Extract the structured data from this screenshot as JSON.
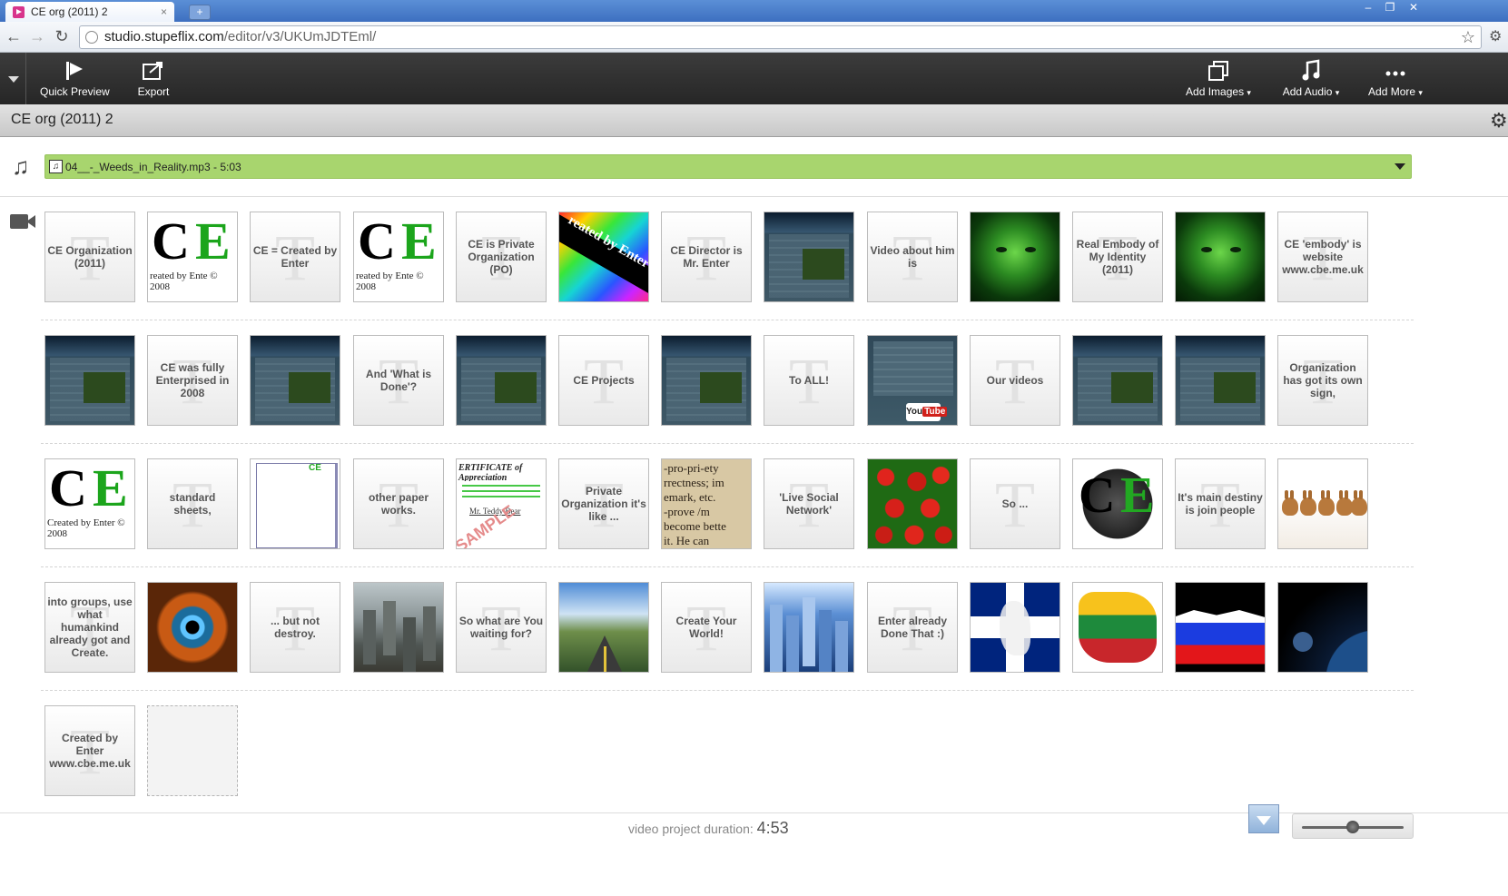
{
  "browser": {
    "tab_title": "CE org (2011) 2",
    "tab_close": "×",
    "new_tab": "+",
    "url_host": "studio.stupeflix.com",
    "url_path": "/editor/v3/UKUmJDTEml/",
    "window_controls": [
      "–",
      "❐",
      "✕"
    ],
    "nav": {
      "back": "←",
      "forward": "→",
      "reload": "↻",
      "star": "☆",
      "wrench": "⚙"
    }
  },
  "toolbar": {
    "quick_preview": "Quick Preview",
    "export": "Export",
    "add_images": "Add Images",
    "add_audio": "Add Audio",
    "add_more": "Add More",
    "caret": "▾"
  },
  "project": {
    "title": "CE org (2011) 2",
    "settings_icon": "⚙"
  },
  "audio": {
    "icon": "♫",
    "track_icon": "♫",
    "track": "04__-_Weeds_in_Reality.mp3 - 5:03",
    "track_color": "#a8d56e"
  },
  "storyboard": {
    "rows": [
      [
        {
          "kind": "text",
          "text": "CE Organization (2011)"
        },
        {
          "kind": "image",
          "style": "ce",
          "text": "CE",
          "sub": "reated by Ente © 2008"
        },
        {
          "kind": "text",
          "text": "CE = Created by Enter"
        },
        {
          "kind": "image",
          "style": "ce",
          "text": "CE",
          "sub": "reated by Ente © 2008"
        },
        {
          "kind": "text",
          "text": "CE is Private Organization (PO)"
        },
        {
          "kind": "image",
          "style": "rainbow",
          "text": "reated by Enter"
        },
        {
          "kind": "text",
          "text": "CE Director is Mr. Enter"
        },
        {
          "kind": "image",
          "style": "site"
        },
        {
          "kind": "text",
          "text": "Video about him is"
        },
        {
          "kind": "image",
          "style": "green"
        },
        {
          "kind": "text",
          "text": "Real Embody of My Identity (2011)"
        },
        {
          "kind": "image",
          "style": "green"
        },
        {
          "kind": "text",
          "text": "CE 'embody' is website www.cbe.me.uk"
        }
      ],
      [
        {
          "kind": "image",
          "style": "site"
        },
        {
          "kind": "text",
          "text": "CE was fully Enterprised in 2008"
        },
        {
          "kind": "image",
          "style": "site"
        },
        {
          "kind": "text",
          "text": "And 'What is Done'?"
        },
        {
          "kind": "image",
          "style": "site"
        },
        {
          "kind": "text",
          "text": "CE Projects"
        },
        {
          "kind": "image",
          "style": "site"
        },
        {
          "kind": "text",
          "text": "To ALL!"
        },
        {
          "kind": "image",
          "style": "yt",
          "text": "You Tube"
        },
        {
          "kind": "text",
          "text": "Our videos"
        },
        {
          "kind": "image",
          "style": "site"
        },
        {
          "kind": "image",
          "style": "site"
        },
        {
          "kind": "text",
          "text": "Organization has got its own sign,"
        }
      ],
      [
        {
          "kind": "image",
          "style": "ce",
          "text": "CE",
          "sub": "Created by Enter © 2008"
        },
        {
          "kind": "text",
          "text": "standard sheets,"
        },
        {
          "kind": "image",
          "style": "paper",
          "text": "CE"
        },
        {
          "kind": "text",
          "text": "other paper works."
        },
        {
          "kind": "image",
          "style": "cert",
          "text": "ERTIFICATE of Appreciation",
          "sub": "Mr. Teddy Bear",
          "mark": "SAMPLE"
        },
        {
          "kind": "text",
          "text": "Private Organization it's like ..."
        },
        {
          "kind": "image",
          "style": "dict",
          "text": "-pro-pri-ety|rrectness; im|emark, etc.|-prove /m|become bette|it. He can|d health. I"
        },
        {
          "kind": "text",
          "text": "'Live Social Network'"
        },
        {
          "kind": "image",
          "style": "straw"
        },
        {
          "kind": "text",
          "text": "So ..."
        },
        {
          "kind": "image",
          "style": "blackce",
          "text": "CE"
        },
        {
          "kind": "text",
          "text": "It's main destiny is join people"
        },
        {
          "kind": "image",
          "style": "rabbits"
        }
      ],
      [
        {
          "kind": "text",
          "text": "into groups, use what humankind already got and Create."
        },
        {
          "kind": "image",
          "style": "eye"
        },
        {
          "kind": "text",
          "text": "... but not destroy."
        },
        {
          "kind": "image",
          "style": "ruins"
        },
        {
          "kind": "text",
          "text": "So what are You waiting for?"
        },
        {
          "kind": "image",
          "style": "road"
        },
        {
          "kind": "text",
          "text": "Create Your World!"
        },
        {
          "kind": "image",
          "style": "city"
        },
        {
          "kind": "text",
          "text": "Enter already Done That :)"
        },
        {
          "kind": "image",
          "style": "uk"
        },
        {
          "kind": "image",
          "style": "lt"
        },
        {
          "kind": "image",
          "style": "ru"
        },
        {
          "kind": "image",
          "style": "space"
        }
      ],
      [
        {
          "kind": "text",
          "text": "Created by Enter www.cbe.me.uk"
        },
        {
          "kind": "placeholder"
        }
      ]
    ]
  },
  "footer": {
    "duration_label": "video project duration:",
    "duration_value": "4:53",
    "zoom_level": 0.5
  }
}
